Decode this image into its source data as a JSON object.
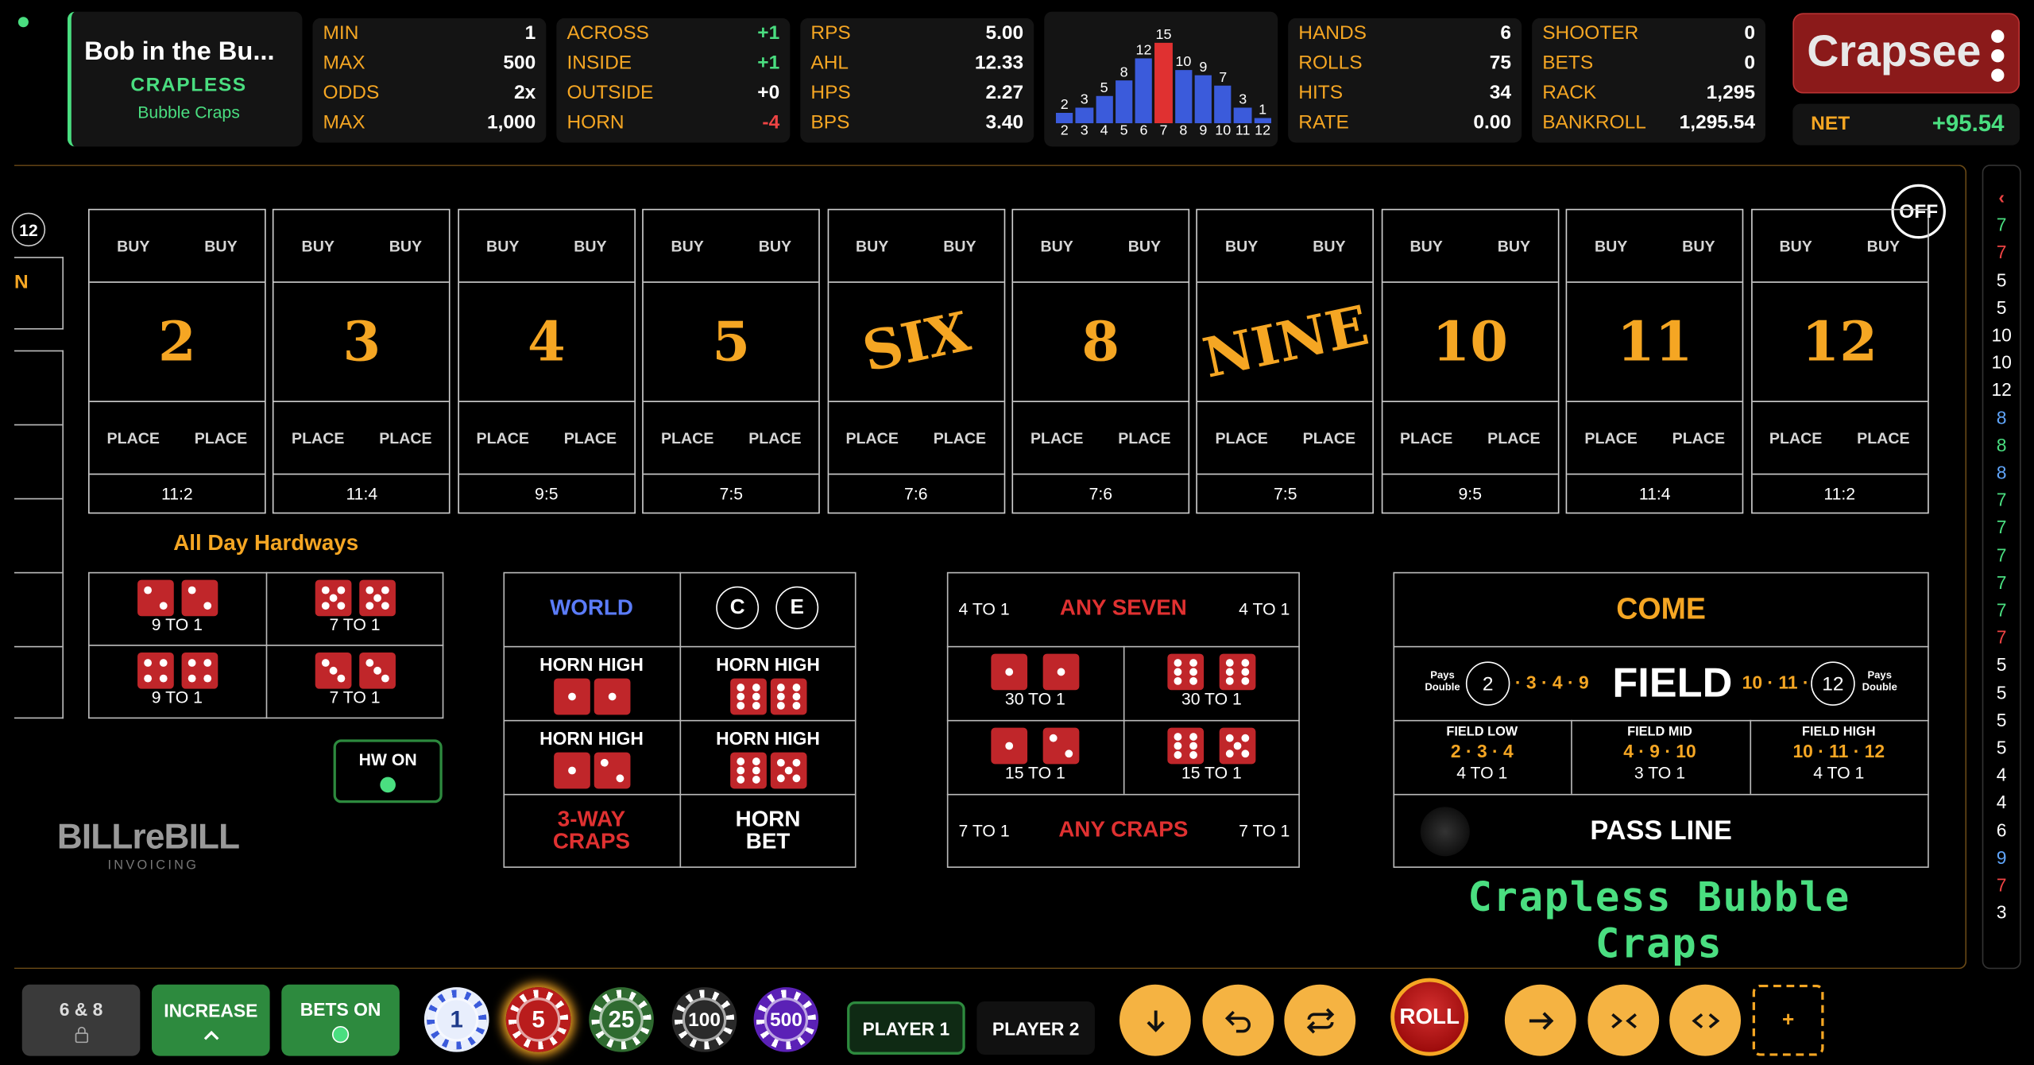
{
  "header": {
    "table_name": "Bob in the Bu...",
    "game_type": "CRAPLESS",
    "game_subtitle": "Bubble Craps"
  },
  "limits": {
    "min_label": "MIN",
    "min": "1",
    "max_label": "MAX",
    "max": "500",
    "odds_label": "ODDS",
    "odds": "2x",
    "max2_label": "MAX",
    "max2": "1,000"
  },
  "groups": {
    "across_label": "ACROSS",
    "across": "+1",
    "inside_label": "INSIDE",
    "inside": "+1",
    "outside_label": "OUTSIDE",
    "outside": "+0",
    "horn_label": "HORN",
    "horn": "-4"
  },
  "rates": {
    "rps_label": "RPS",
    "rps": "5.00",
    "ahl_label": "AHL",
    "ahl": "12.33",
    "hps_label": "HPS",
    "hps": "2.27",
    "bps_label": "BPS",
    "bps": "3.40"
  },
  "histogram": {
    "labels": [
      "2",
      "3",
      "4",
      "5",
      "6",
      "7",
      "8",
      "9",
      "10",
      "11",
      "12"
    ],
    "counts": [
      2,
      3,
      5,
      8,
      12,
      15,
      10,
      9,
      7,
      3,
      1
    ],
    "count_labels": [
      "2",
      "3",
      "5",
      "8",
      "12",
      "15",
      "10",
      "9",
      "7",
      "3",
      "1"
    ],
    "bar_color": "#3b5bdb",
    "seven_color": "#e03131"
  },
  "session": {
    "hands_label": "HANDS",
    "hands": "6",
    "rolls_label": "ROLLS",
    "rolls": "75",
    "hits_label": "HITS",
    "hits": "34",
    "rate_label": "RATE",
    "rate": "0.00"
  },
  "money": {
    "shooter_label": "SHOOTER",
    "shooter": "0",
    "bets_label": "BETS",
    "bets": "0",
    "rack_label": "RACK",
    "rack": "1,295",
    "bankroll_label": "BANKROLL",
    "bankroll": "1,295.54"
  },
  "brand": {
    "logo": "Crapsee",
    "net_label": "NET",
    "net": "+95.54"
  },
  "table": {
    "off_label": "OFF",
    "left_stub_number": "12",
    "left_stub_letter": "N",
    "buy_label": "BUY",
    "place_label": "PLACE",
    "numbers": [
      {
        "label": "2",
        "pay": "11:2"
      },
      {
        "label": "3",
        "pay": "11:4"
      },
      {
        "label": "4",
        "pay": "9:5"
      },
      {
        "label": "5",
        "pay": "7:5"
      },
      {
        "label": "SIX",
        "pay": "7:6"
      },
      {
        "label": "8",
        "pay": "7:6"
      },
      {
        "label": "NINE",
        "pay": "7:5"
      },
      {
        "label": "10",
        "pay": "9:5"
      },
      {
        "label": "11",
        "pay": "11:4"
      },
      {
        "label": "12",
        "pay": "11:2"
      }
    ],
    "hardways_title": "All Day Hardways",
    "hardways": [
      "9 TO 1",
      "7 TO 1",
      "9 TO 1",
      "7 TO 1"
    ],
    "hw_label": "HW ON",
    "watermark_main": "BILLreBILL",
    "watermark_sub": "INVOICING",
    "horn": {
      "world": "WORLD",
      "c": "C",
      "e": "E",
      "horn_high": "HORN HIGH",
      "three_way_1": "3-WAY",
      "three_way_2": "CRAPS",
      "horn_bet_1": "HORN",
      "horn_bet_2": "BET"
    },
    "props": {
      "any_seven": "ANY SEVEN",
      "any_seven_pay": "4 TO 1",
      "any_craps": "ANY CRAPS",
      "any_craps_pay": "7 TO 1",
      "pays": [
        "30 TO 1",
        "30 TO 1",
        "15 TO 1",
        "15 TO 1"
      ]
    },
    "field": {
      "come": "COME",
      "field": "FIELD",
      "pays_double": "Pays Double",
      "two": "2",
      "twelve": "12",
      "left_nums": "· 3 · 4 · 9",
      "right_nums": "10 · 11 ·",
      "low_title": "FIELD LOW",
      "low_nums": "2 · 3 · 4",
      "low_pay": "4 TO 1",
      "mid_title": "FIELD MID",
      "mid_nums": "4 · 9 · 10",
      "mid_pay": "3 TO 1",
      "high_title": "FIELD HIGH",
      "high_nums": "10 · 11 · 12",
      "high_pay": "4 TO 1",
      "pass_line": "PASS LINE"
    },
    "game_title": "Crapless Bubble Craps"
  },
  "roll_history": {
    "values": [
      "7",
      "7",
      "5",
      "5",
      "10",
      "10",
      "12",
      "8",
      "8",
      "8",
      "7",
      "7",
      "7",
      "7",
      "7",
      "7",
      "5",
      "5",
      "5",
      "5",
      "4",
      "4",
      "6",
      "9",
      "7",
      "3"
    ],
    "colors": [
      "#4ade80",
      "#ef4444",
      "#fff",
      "#fff",
      "#fff",
      "#fff",
      "#fff",
      "#60a5fa",
      "#4ade80",
      "#60a5fa",
      "#4ade80",
      "#4ade80",
      "#4ade80",
      "#4ade80",
      "#4ade80",
      "#ef4444",
      "#fff",
      "#fff",
      "#fff",
      "#fff",
      "#fff",
      "#fff",
      "#fff",
      "#60a5fa",
      "#ef4444",
      "#fff"
    ]
  },
  "controls": {
    "six_eight": "6 & 8",
    "increase": "INCREASE",
    "bets_on": "BETS ON",
    "chips": [
      "1",
      "5",
      "25",
      "100",
      "500"
    ],
    "player1": "PLAYER 1",
    "player2": "PLAYER 2",
    "roll": "ROLL",
    "plus": "+"
  }
}
